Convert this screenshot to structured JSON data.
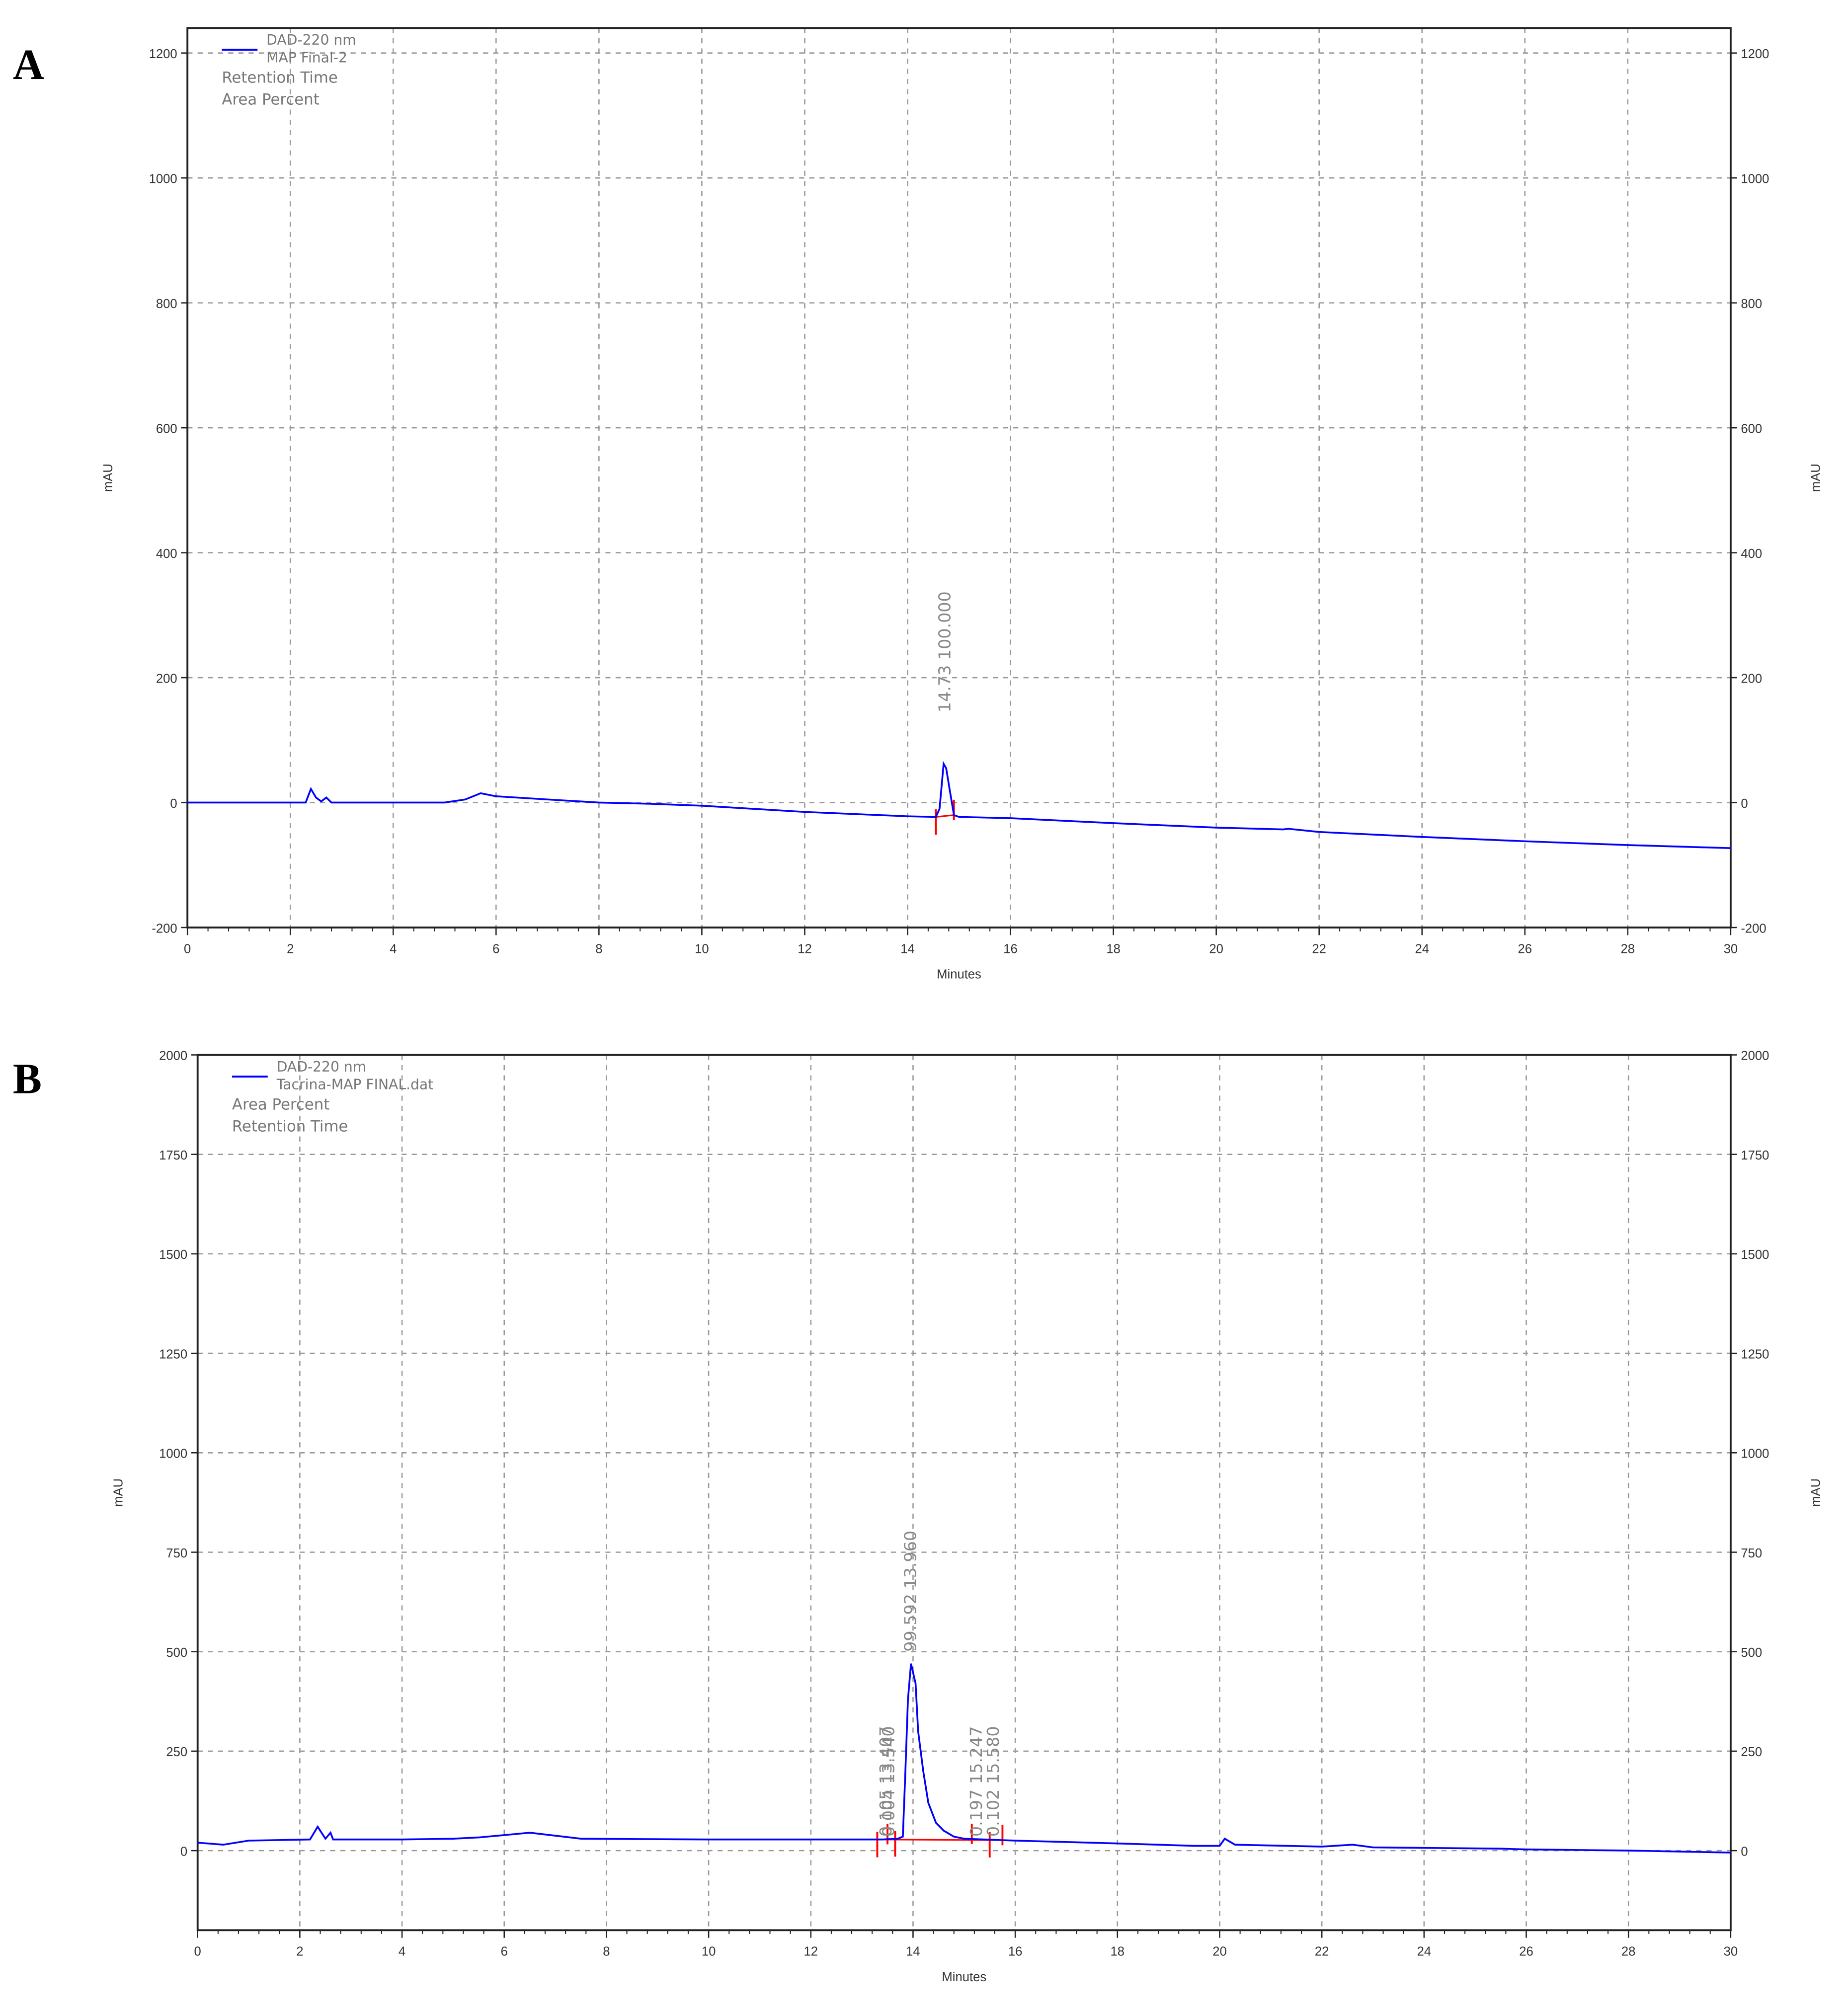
{
  "chart_data": [
    {
      "type": "line",
      "panel_label": "A",
      "xlabel": "Minutes",
      "ylabel": "mAU",
      "xlim": [
        0,
        30
      ],
      "ylim": [
        -200,
        1240
      ],
      "xticks": [
        0,
        2,
        4,
        6,
        8,
        10,
        12,
        14,
        16,
        18,
        20,
        22,
        24,
        26,
        28,
        30
      ],
      "yticks": [
        -200,
        0,
        200,
        400,
        600,
        800,
        1000,
        1200
      ],
      "grid": true,
      "legend": {
        "placement": "top-left",
        "series_label_1": "DAD-220 nm",
        "series_label_2": "MAP Final-2",
        "line1": "Retention Time",
        "line2": "Area Percent"
      },
      "series_color": "#0000ff",
      "integration_color": "#ff0000",
      "trace": {
        "x": [
          0,
          2.3,
          2.4,
          2.5,
          2.6,
          2.7,
          2.8,
          3,
          5,
          5.4,
          5.7,
          6,
          7,
          8,
          9,
          10,
          12,
          14,
          14.55,
          14.62,
          14.7,
          14.75,
          14.82,
          14.9,
          15,
          16,
          18,
          20,
          21.3,
          21.4,
          22,
          24,
          26,
          28,
          30
        ],
        "y": [
          0,
          0,
          22,
          8,
          2,
          8,
          0,
          0,
          0,
          5,
          15,
          10,
          5,
          0,
          -2,
          -5,
          -15,
          -22,
          -23,
          -10,
          62,
          55,
          20,
          -20,
          -23,
          -25,
          -33,
          -40,
          -43,
          -42,
          -47,
          -55,
          -62,
          -68,
          -73
        ]
      },
      "integration_marks": [
        14.55,
        14.9
      ],
      "peaks": [
        {
          "rt": "14.73",
          "area_percent": "100.000",
          "x": 14.73
        }
      ]
    },
    {
      "type": "line",
      "panel_label": "B",
      "xlabel": "Minutes",
      "ylabel": "mAU",
      "xlim": [
        0,
        30
      ],
      "ylim": [
        -200,
        2000
      ],
      "xticks": [
        0,
        2,
        4,
        6,
        8,
        10,
        12,
        14,
        16,
        18,
        20,
        22,
        24,
        26,
        28,
        30
      ],
      "yticks": [
        0,
        250,
        500,
        750,
        1000,
        1250,
        1500,
        1750,
        2000
      ],
      "grid": true,
      "legend": {
        "placement": "top-left",
        "series_label_1": "DAD-220 nm",
        "series_label_2": "Tacrina-MAP FINAL.dat",
        "line1": "Area Percent",
        "line2": "Retention Time"
      },
      "series_color": "#0000ff",
      "integration_color": "#ff0000",
      "trace": {
        "x": [
          0,
          0.5,
          1,
          2.2,
          2.35,
          2.5,
          2.6,
          2.65,
          2.75,
          4,
          5,
          5.5,
          6.5,
          7.5,
          10,
          13.4,
          13.7,
          13.8,
          13.85,
          13.9,
          13.96,
          14.05,
          14.1,
          14.2,
          14.3,
          14.45,
          14.6,
          14.8,
          15,
          16,
          18,
          19.5,
          20,
          20.1,
          20.3,
          22,
          22.6,
          23,
          25.5,
          26,
          28,
          30
        ],
        "y": [
          20,
          15,
          25,
          28,
          60,
          30,
          45,
          28,
          28,
          28,
          30,
          33,
          45,
          30,
          28,
          28,
          30,
          35,
          200,
          380,
          470,
          420,
          300,
          200,
          120,
          70,
          50,
          35,
          30,
          25,
          18,
          12,
          12,
          30,
          15,
          10,
          15,
          8,
          5,
          3,
          0,
          -5
        ]
      },
      "integration_marks": [
        13.3,
        13.5,
        13.65,
        15.15,
        15.5,
        15.75
      ],
      "peaks": [
        {
          "rt": "13.407",
          "area_percent": "0.105",
          "x": 13.48
        },
        {
          "rt": "13.540",
          "area_percent": "0.004",
          "x": 13.53
        },
        {
          "rt": "13.960",
          "area_percent": "99.592",
          "x": 13.96
        },
        {
          "rt": "15.247",
          "area_percent": "0.197",
          "x": 15.25
        },
        {
          "rt": "15.580",
          "area_percent": "0.102",
          "x": 15.58
        }
      ]
    }
  ]
}
